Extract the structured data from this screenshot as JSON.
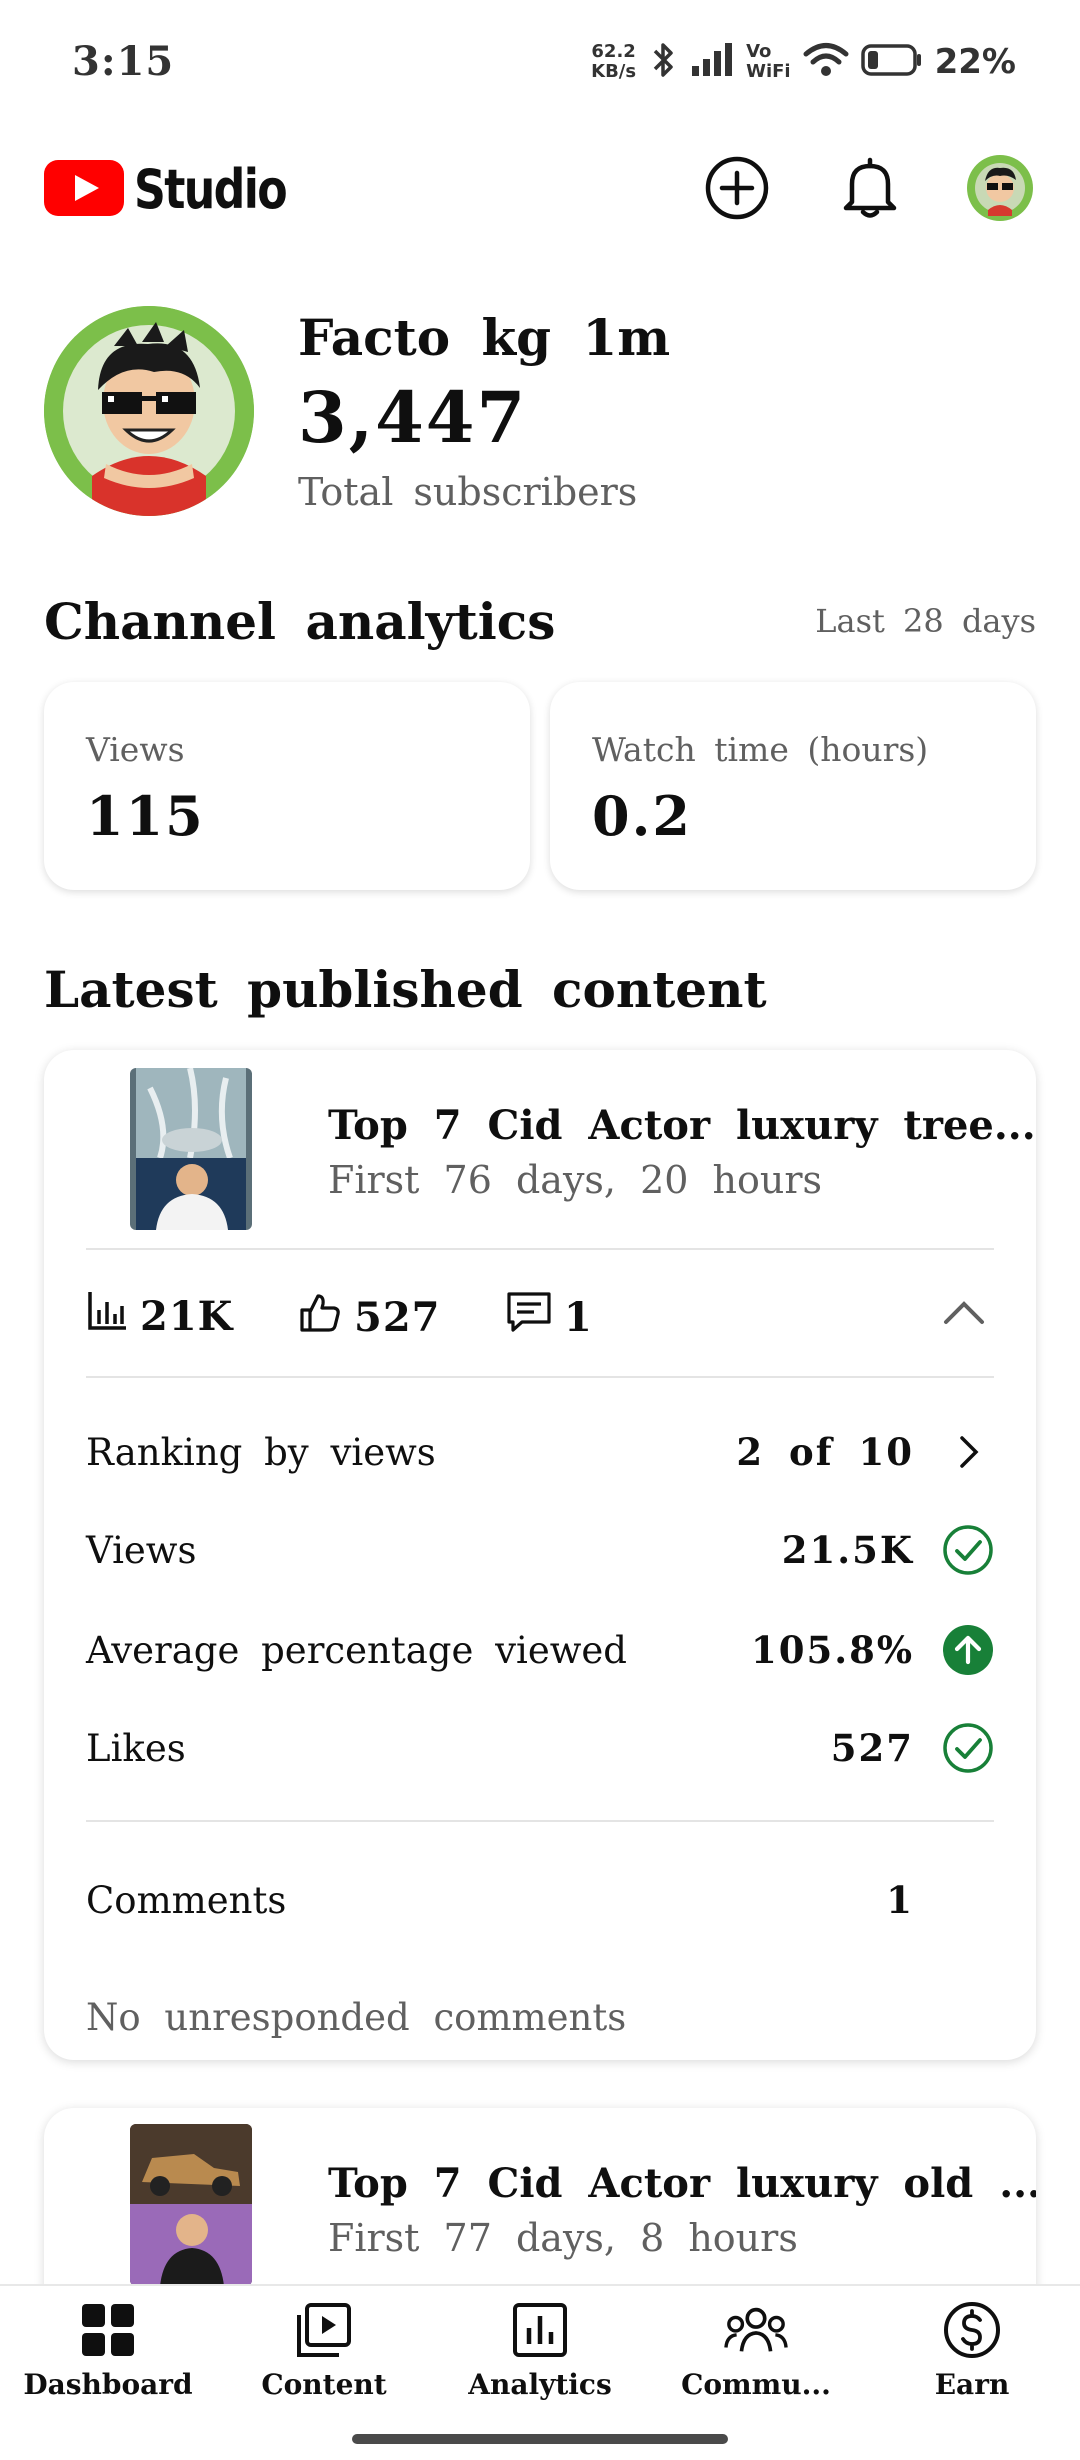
{
  "status_bar": {
    "time": "3:15",
    "net_speed_value": "62.2",
    "net_speed_unit": "KB/s",
    "vowifi_top": "Vo",
    "vowifi_bottom": "WiFi",
    "battery": "22%"
  },
  "app": {
    "logo_text": "Studio",
    "brand_color": "#ff0000",
    "header_icons": [
      "create-plus-icon",
      "notifications-bell-icon",
      "account-avatar"
    ]
  },
  "channel": {
    "name": "Facto kg 1m",
    "subscriber_count": "3,447",
    "subscriber_label": "Total subscribers"
  },
  "analytics": {
    "title": "Channel analytics",
    "period": "Last 28 days",
    "cards": [
      {
        "label": "Views",
        "value": "115"
      },
      {
        "label": "Watch time (hours)",
        "value": "0.2"
      }
    ]
  },
  "latest": {
    "title": "Latest published content",
    "items": [
      {
        "title": "Top 7 Cid Actor luxury tree...",
        "subtitle": "First 76 days, 20 hours",
        "views": "21K",
        "likes": "527",
        "comments": "1",
        "ranking_label": "Ranking by views",
        "ranking_value": "2 of 10",
        "rows": [
          {
            "label": "Views",
            "value": "21.5K",
            "status": "check-circle-icon"
          },
          {
            "label": "Average percentage viewed",
            "value": "105.8%",
            "status": "arrow-up-circle-icon"
          },
          {
            "label": "Likes",
            "value": "527",
            "status": "check-circle-icon"
          }
        ],
        "comments_label": "Comments",
        "comments_value": "1",
        "comments_note": "No unresponded comments"
      },
      {
        "title": "Top 7 Cid Actor luxury old ...",
        "subtitle": "First 77 days, 8 hours"
      }
    ]
  },
  "bottom_nav": [
    {
      "label": "Dashboard",
      "icon": "dashboard-icon"
    },
    {
      "label": "Content",
      "icon": "content-icon"
    },
    {
      "label": "Analytics",
      "icon": "analytics-icon"
    },
    {
      "label": "Commu...",
      "icon": "community-icon"
    },
    {
      "label": "Earn",
      "icon": "earn-icon"
    }
  ],
  "colors": {
    "success_green": "#188038",
    "secondary_text": "#606060"
  }
}
